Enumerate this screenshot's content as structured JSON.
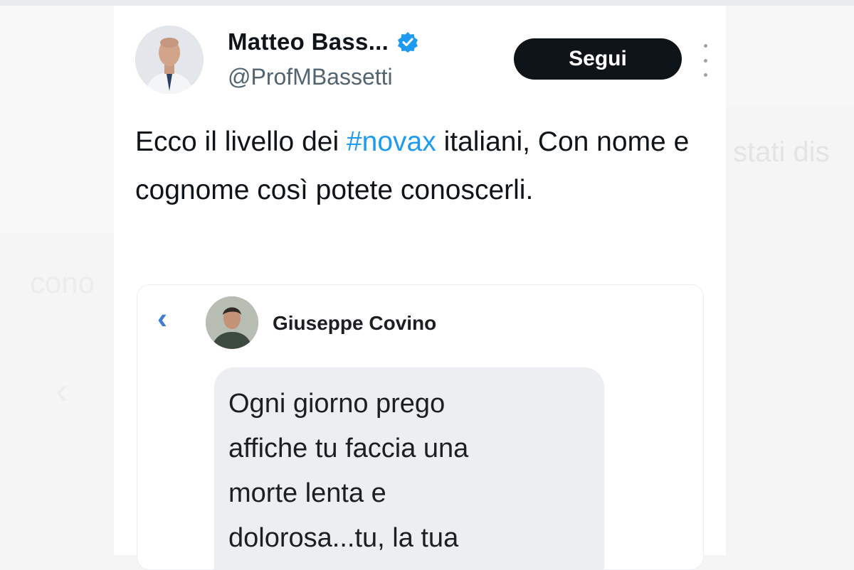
{
  "background": {
    "right_fragment": "stati dis",
    "left_fragment": "cono",
    "left_chevron": "‹"
  },
  "tweet": {
    "author_name": "Matteo Bass...",
    "author_handle": "@ProfMBassetti",
    "verified": true,
    "follow_label": "Segui",
    "text_before_hashtag": "Ecco il livello dei ",
    "hashtag": "#novax",
    "text_after_hashtag": " italiani, Con nome e cognome così potete conoscerli."
  },
  "embedded_screenshot": {
    "back_icon": "‹",
    "contact_name": "Giuseppe Covino",
    "message_lines": [
      "Ogni giorno prego",
      "affiche tu faccia una",
      "morte lenta e",
      "dolorosa...tu, la tua"
    ]
  },
  "colors": {
    "accent_blue": "#1d9bf0",
    "follow_button_bg": "#0f1419",
    "bubble_bg": "#edeef2"
  },
  "icons": [
    "verified-badge-icon",
    "more-options-icon",
    "back-chevron-icon"
  ]
}
